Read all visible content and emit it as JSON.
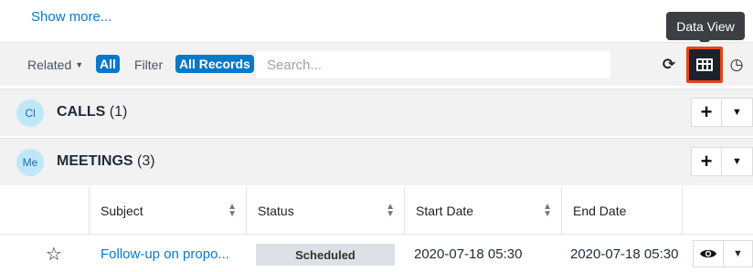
{
  "show_more": "Show more...",
  "tooltip": "Data View",
  "toolbar": {
    "related_label": "Related",
    "related_value": "All",
    "filter_label": "Filter",
    "filter_value": "All Records",
    "search_placeholder": "Search..."
  },
  "subpanels": [
    {
      "icon": "Cl",
      "name": "CALLS",
      "count": "(1)"
    },
    {
      "icon": "Me",
      "name": "MEETINGS",
      "count": "(3)"
    }
  ],
  "table": {
    "columns": [
      "Subject",
      "Status",
      "Start Date",
      "End Date"
    ],
    "rows": [
      {
        "subject": "Follow-up on propo...",
        "status": "Scheduled",
        "start": "2020-07-18 05:30",
        "end": "2020-07-18 05:30"
      }
    ]
  },
  "colors": {
    "accent": "#0679c8",
    "highlight": "#e2471a",
    "panel_bg": "#f2f2f2"
  }
}
